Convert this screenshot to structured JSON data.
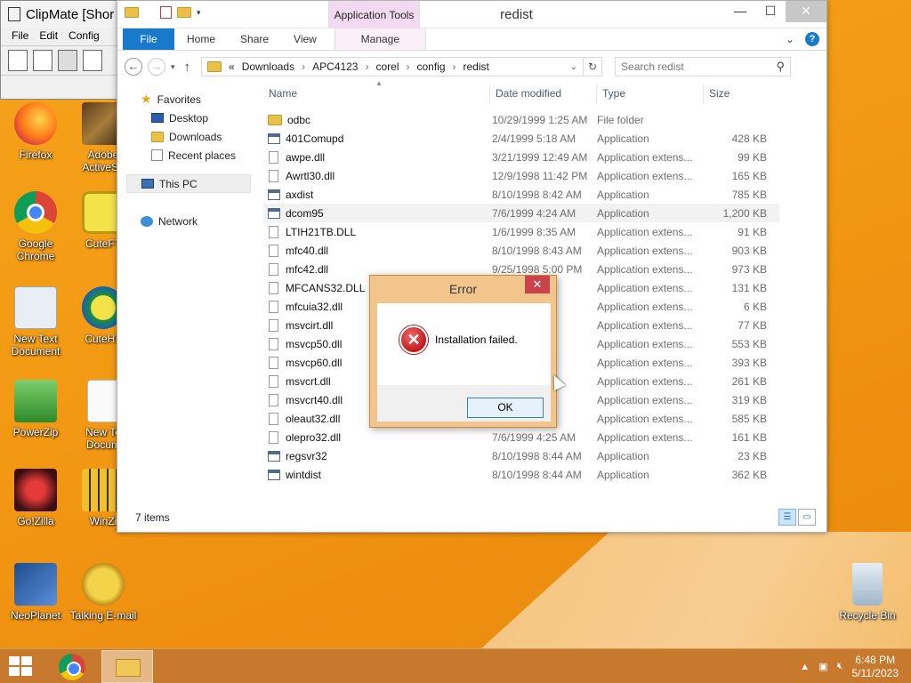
{
  "clipmate": {
    "title": "ClipMate [Shor",
    "menu": [
      "File",
      "Edit",
      "Config"
    ]
  },
  "desktop_icons": [
    {
      "label": "Firefox",
      "icon": "firefox-icon"
    },
    {
      "label": "Adobe ActiveSh",
      "icon": "adobe-icon"
    },
    {
      "label": "Google Chrome",
      "icon": "chrome-icon"
    },
    {
      "label": "CuteFT",
      "icon": "cuteftp-icon"
    },
    {
      "label": "New Text Document",
      "icon": "gear-icon"
    },
    {
      "label": "CuteHT",
      "icon": "cutehtml-icon"
    },
    {
      "label": "PowerZip",
      "icon": "powerzip-icon"
    },
    {
      "label": "New Te Docum",
      "icon": "document-icon"
    },
    {
      "label": "Go!Zilla",
      "icon": "gozilla-icon"
    },
    {
      "label": "WinZi",
      "icon": "winzip-icon"
    },
    {
      "label": "NeoPlanet",
      "icon": "neoplanet-icon"
    },
    {
      "label": "Talking E-mail",
      "icon": "talking-email-icon"
    },
    {
      "label": "Recycle Bin",
      "icon": "recycle-bin-icon"
    }
  ],
  "explorer": {
    "app_tools": "Application Tools",
    "title": "redist",
    "ribbon": {
      "file": "File",
      "home": "Home",
      "share": "Share",
      "view": "View",
      "manage": "Manage"
    },
    "address": [
      "Downloads",
      "APC4123",
      "corel",
      "config",
      "redist"
    ],
    "address_prefix": "«",
    "search_placeholder": "Search redist",
    "nav": {
      "favorites": "Favorites",
      "desktop": "Desktop",
      "downloads": "Downloads",
      "recent": "Recent places",
      "thispc": "This PC",
      "network": "Network"
    },
    "columns": {
      "name": "Name",
      "date": "Date modified",
      "type": "Type",
      "size": "Size"
    },
    "files": [
      {
        "name": "odbc",
        "date": "10/29/1999 1:25 AM",
        "type": "File folder",
        "size": "",
        "kind": "folder"
      },
      {
        "name": "401Comupd",
        "date": "2/4/1999 5:18 AM",
        "type": "Application",
        "size": "428 KB",
        "kind": "app"
      },
      {
        "name": "awpe.dll",
        "date": "3/21/1999 12:49 AM",
        "type": "Application extens...",
        "size": "99 KB",
        "kind": "dll"
      },
      {
        "name": "Awrtl30.dll",
        "date": "12/9/1998 11:42 PM",
        "type": "Application extens...",
        "size": "165 KB",
        "kind": "dll"
      },
      {
        "name": "axdist",
        "date": "8/10/1998 8:42 AM",
        "type": "Application",
        "size": "785 KB",
        "kind": "app"
      },
      {
        "name": "dcom95",
        "date": "7/6/1999 4:24 AM",
        "type": "Application",
        "size": "1,200 KB",
        "kind": "app"
      },
      {
        "name": "LTIH21TB.DLL",
        "date": "1/6/1999 8:35 AM",
        "type": "Application extens...",
        "size": "91 KB",
        "kind": "dll"
      },
      {
        "name": "mfc40.dll",
        "date": "8/10/1998 8:43 AM",
        "type": "Application extens...",
        "size": "903 KB",
        "kind": "dll"
      },
      {
        "name": "mfc42.dll",
        "date": "9/25/1998 5:00 PM",
        "type": "Application extens...",
        "size": "973 KB",
        "kind": "dll"
      },
      {
        "name": "MFCANS32.DLL",
        "date": "50 AM",
        "type": "Application extens...",
        "size": "131 KB",
        "kind": "dll"
      },
      {
        "name": "mfcuia32.dll",
        "date": "50 AM",
        "type": "Application extens...",
        "size": "6 KB",
        "kind": "dll"
      },
      {
        "name": "msvcirt.dll",
        "date": "00 PM",
        "type": "Application extens...",
        "size": "77 KB",
        "kind": "dll"
      },
      {
        "name": "msvcp50.dll",
        "date": "43 AM",
        "type": "Application extens...",
        "size": "553 KB",
        "kind": "dll"
      },
      {
        "name": "msvcp60.dll",
        "date": "13 AM",
        "type": "Application extens...",
        "size": "393 KB",
        "kind": "dll"
      },
      {
        "name": "msvcrt.dll",
        "date": "00 PM",
        "type": "Application extens...",
        "size": "261 KB",
        "kind": "dll"
      },
      {
        "name": "msvcrt40.dll",
        "date": "00 PM",
        "type": "Application extens...",
        "size": "319 KB",
        "kind": "dll"
      },
      {
        "name": "oleaut32.dll",
        "date": "52 AM",
        "type": "Application extens...",
        "size": "585 KB",
        "kind": "dll"
      },
      {
        "name": "olepro32.dll",
        "date": "7/6/1999 4:25 AM",
        "type": "Application extens...",
        "size": "161 KB",
        "kind": "dll"
      },
      {
        "name": "regsvr32",
        "date": "8/10/1998 8:44 AM",
        "type": "Application",
        "size": "23 KB",
        "kind": "app"
      },
      {
        "name": "wintdist",
        "date": "8/10/1998 8:44 AM",
        "type": "Application",
        "size": "362 KB",
        "kind": "app"
      }
    ],
    "status": "7 items"
  },
  "dialog": {
    "title": "Error",
    "message": "Installation failed.",
    "ok": "OK",
    "icon": "error-icon"
  },
  "taskbar": {
    "time": "6:48 PM",
    "date": "5/11/2023"
  },
  "colors": {
    "accent": "#1979ca",
    "dialog_frame": "#f1c58c",
    "taskbar": "#c7792e"
  }
}
